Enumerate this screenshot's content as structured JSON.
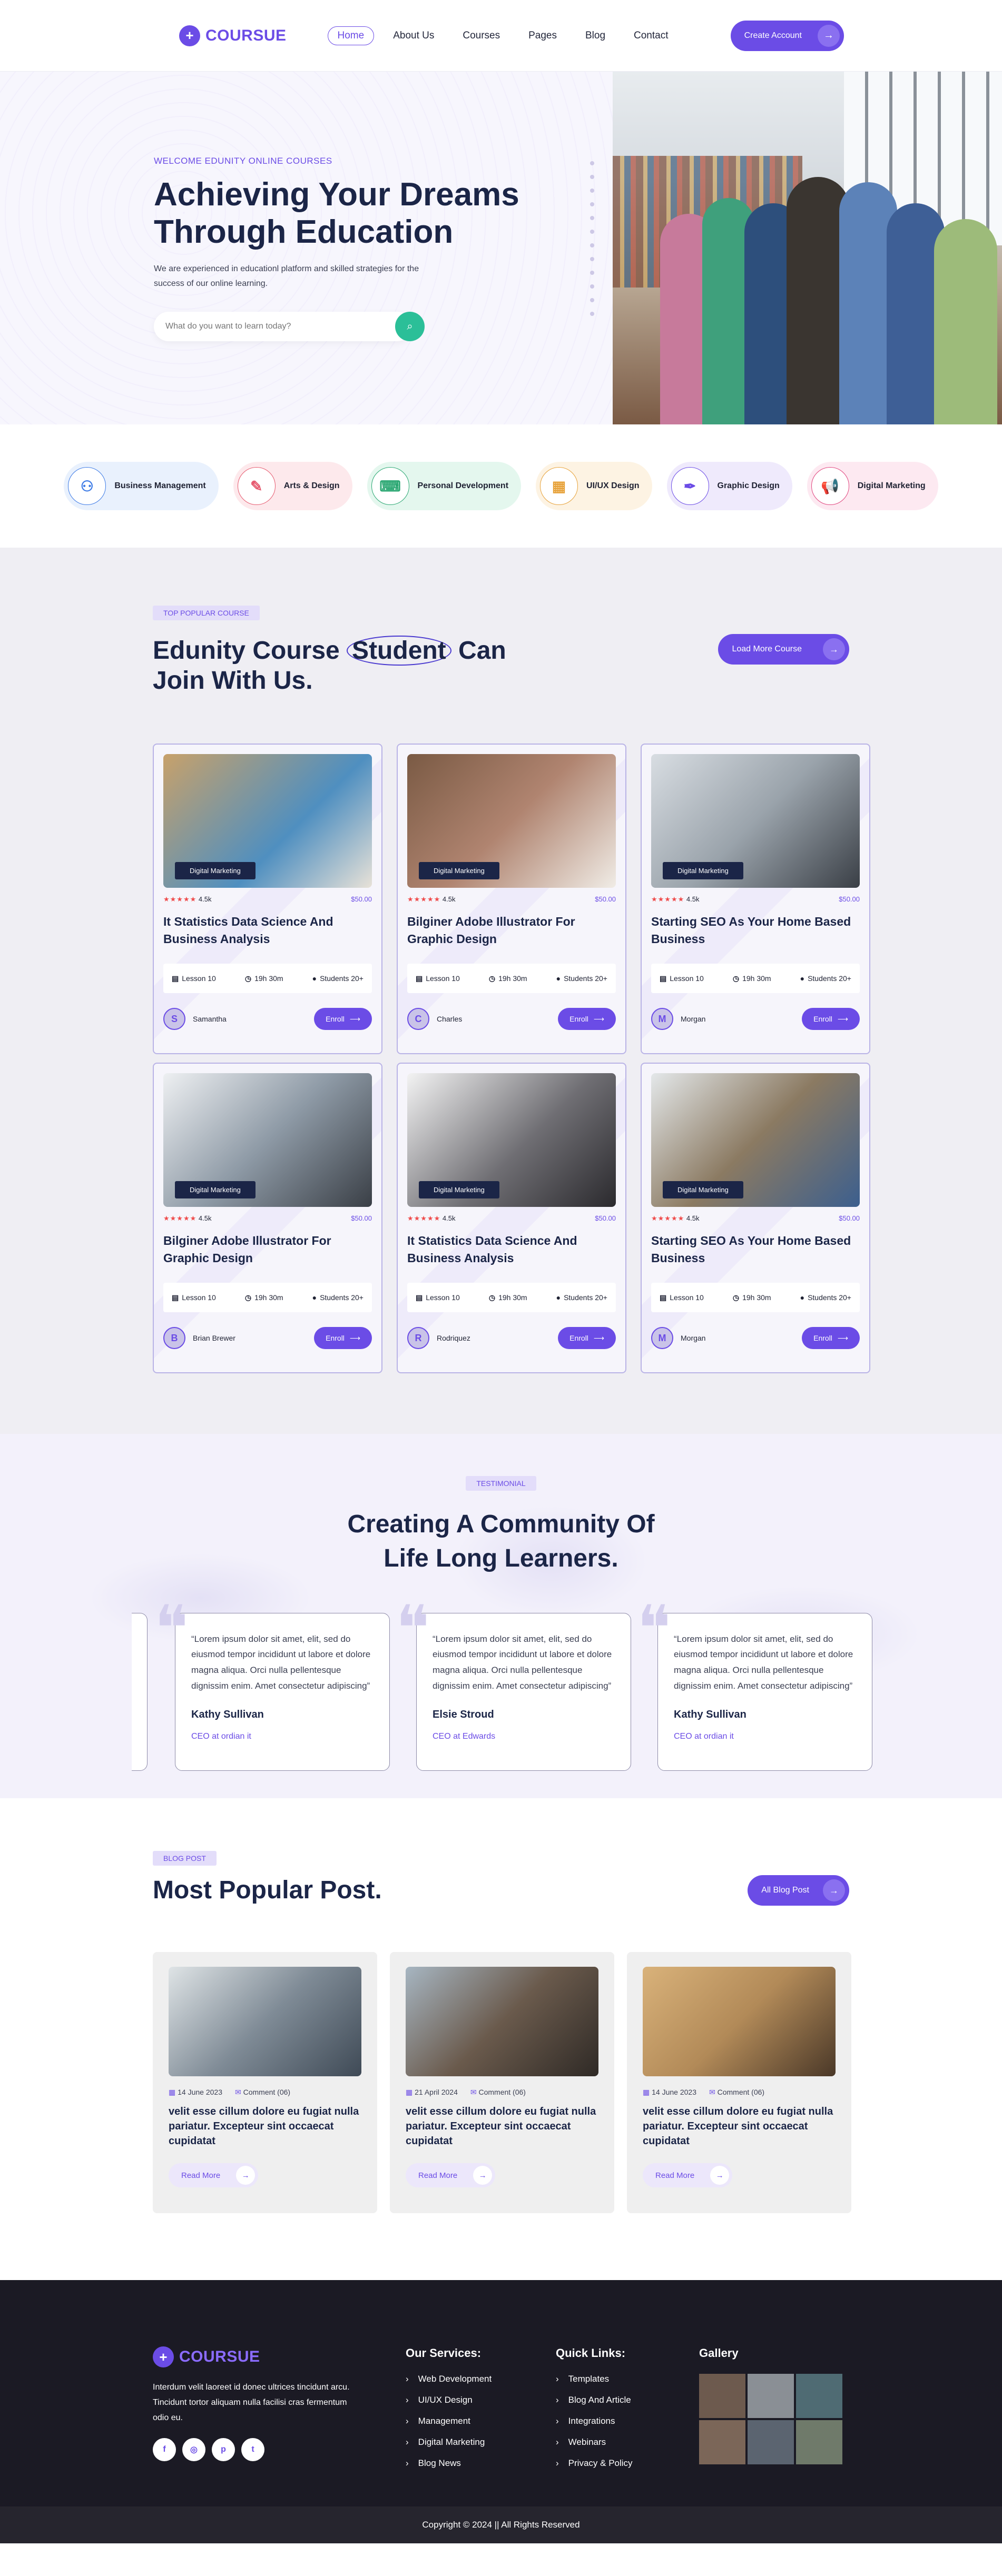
{
  "brand": {
    "name": "COURSUE",
    "mark": "+"
  },
  "nav": {
    "items": [
      {
        "label": "Home",
        "active": true
      },
      {
        "label": "About Us"
      },
      {
        "label": "Courses"
      },
      {
        "label": "Pages"
      },
      {
        "label": "Blog"
      },
      {
        "label": "Contact"
      }
    ],
    "cta": "Create Account",
    "cta_icon": "arrow-right-icon"
  },
  "hero": {
    "eyebrow": "WELCOME EDUNITY ONLINE COURSES",
    "title": "Achieving Your Dreams Through Education",
    "subtitle": "We are experienced in educationl platform and skilled strategies for the success of our online learning.",
    "search_placeholder": "What do you want to learn today?",
    "search_icon": "search-icon"
  },
  "categories": [
    {
      "label": "Business Management",
      "bg": "#e9f1fd",
      "color": "#3d7be6",
      "icon": "team-icon"
    },
    {
      "label": "Arts & Design",
      "bg": "#fde9ec",
      "color": "#e65a6f",
      "icon": "palette-icon"
    },
    {
      "label": "Personal Development",
      "bg": "#e4f7ee",
      "color": "#2aa772",
      "icon": "code-icon"
    },
    {
      "label": "UI/UX Design",
      "bg": "#fdf3e3",
      "color": "#e7a23a",
      "icon": "design-icon"
    },
    {
      "label": "Graphic Design",
      "bg": "#efeafc",
      "color": "#6b4ce6",
      "icon": "pen-icon"
    },
    {
      "label": "Digital Marketing",
      "bg": "#fde9f1",
      "color": "#e0457e",
      "icon": "megaphone-icon"
    }
  ],
  "courses": {
    "pill": "TOP POPULAR COURSE",
    "title_a": "Edunity Course ",
    "title_b": "Student",
    "title_c": " Can Join With Us.",
    "load_more": "Load More Course",
    "items": [
      {
        "tag": "Digital Marketing",
        "rating": "4.5k",
        "price": "$50.00",
        "title": "It Statistics Data Science And Business Analysis",
        "lessons": "Lesson 10",
        "time": "19h 30m",
        "students": "Students 20+",
        "instructor": "Samantha",
        "enroll": "Enroll",
        "thumb": "#4f8fc0"
      },
      {
        "tag": "Digital Marketing",
        "rating": "4.5k",
        "price": "$50.00",
        "title": "Bilginer Adobe Illustrator For Graphic Design",
        "lessons": "Lesson 10",
        "time": "19h 30m",
        "students": "Students 20+",
        "instructor": "Charles",
        "enroll": "Enroll",
        "thumb": "#b08470"
      },
      {
        "tag": "Digital Marketing",
        "rating": "4.5k",
        "price": "$50.00",
        "title": "Starting SEO As Your Home Based Business",
        "lessons": "Lesson 10",
        "time": "19h 30m",
        "students": "Students 20+",
        "instructor": "Morgan",
        "enroll": "Enroll",
        "thumb": "#9aa3ab"
      },
      {
        "tag": "Digital Marketing",
        "rating": "4.5k",
        "price": "$50.00",
        "title": "Bilginer Adobe Illustrator For Graphic Design",
        "lessons": "Lesson 10",
        "time": "19h 30m",
        "students": "Students 20+",
        "instructor": "Brian Brewer",
        "enroll": "Enroll",
        "thumb": "#8e9aa6"
      },
      {
        "tag": "Digital Marketing",
        "rating": "4.5k",
        "price": "$50.00",
        "title": "It Statistics Data Science And Business Analysis",
        "lessons": "Lesson 10",
        "time": "19h 30m",
        "students": "Students 20+",
        "instructor": "Rodriquez",
        "enroll": "Enroll",
        "thumb": "#6f6e73"
      },
      {
        "tag": "Digital Marketing",
        "rating": "4.5k",
        "price": "$50.00",
        "title": "Starting SEO As Your Home Based Business",
        "lessons": "Lesson 10",
        "time": "19h 30m",
        "students": "Students 20+",
        "instructor": "Morgan",
        "enroll": "Enroll",
        "thumb": "#8b7a62"
      }
    ]
  },
  "testimonial": {
    "pill": "TESTIMONIAL",
    "title": "Creating A Community Of Life Long Learners.",
    "items": [
      {
        "text": "“Lorem ipsum dolor sit amet, elit, sed do eiusmod tempor incididunt ut labore et dolore magna aliqua. Orci nulla pellentesque dignissim enim. Amet consectetur adipiscing”",
        "name": "Kathy Sullivan",
        "role": "CEO at ordian it"
      },
      {
        "text": "“Lorem ipsum dolor sit amet, elit, sed do eiusmod tempor incididunt ut labore et dolore magna aliqua. Orci nulla pellentesque dignissim enim. Amet consectetur adipiscing”",
        "name": "Elsie Stroud",
        "role": "CEO at Edwards"
      },
      {
        "text": "“Lorem ipsum dolor sit amet, elit, sed do eiusmod tempor incididunt ut labore et dolore magna aliqua. Orci nulla pellentesque dignissim enim. Amet consectetur adipiscing”",
        "name": "Kathy Sullivan",
        "role": "CEO at ordian it"
      }
    ]
  },
  "blog": {
    "pill": "BLOG POST",
    "title": "Most Popular Post.",
    "all": "All Blog Post",
    "items": [
      {
        "date": "14 June 2023",
        "comments": "Comment (06)",
        "title": "velit esse cillum dolore eu fugiat nulla pariatur. Excepteur sint occaecat cupidatat",
        "read": "Read More",
        "thumb": "#7f8b96"
      },
      {
        "date": "21 April 2024",
        "comments": "Comment (06)",
        "title": "velit esse cillum dolore eu fugiat nulla pariatur. Excepteur sint occaecat cupidatat",
        "read": "Read More",
        "thumb": "#6a5a4c"
      },
      {
        "date": "14 June 2023",
        "comments": "Comment (06)",
        "title": "velit esse cillum dolore eu fugiat nulla pariatur. Excepteur sint occaecat cupidatat",
        "read": "Read More",
        "thumb": "#b28a58"
      }
    ]
  },
  "footer": {
    "desc": "Interdum velit laoreet id donec ultrices tincidunt arcu. Tincidunt tortor aliquam nulla facilisi cras fermentum odio eu.",
    "socials": [
      "f",
      "◎",
      "p",
      "t"
    ],
    "services_title": "Our Services:",
    "services": [
      "Web Development",
      "UI/UX Design",
      "Management",
      "Digital Marketing",
      "Blog News"
    ],
    "links_title": "Quick Links:",
    "links": [
      "Templates",
      "Blog And Article",
      "Integrations",
      "Webinars",
      "Privacy & Policy"
    ],
    "gallery_title": "Gallery",
    "gallery": [
      "#6d5a4e",
      "#8a8f95",
      "#4f6b73",
      "#7b6658",
      "#5b6470",
      "#6f7a6a"
    ],
    "copyright": "Copyright © 2024  || All Rights Reserved"
  }
}
